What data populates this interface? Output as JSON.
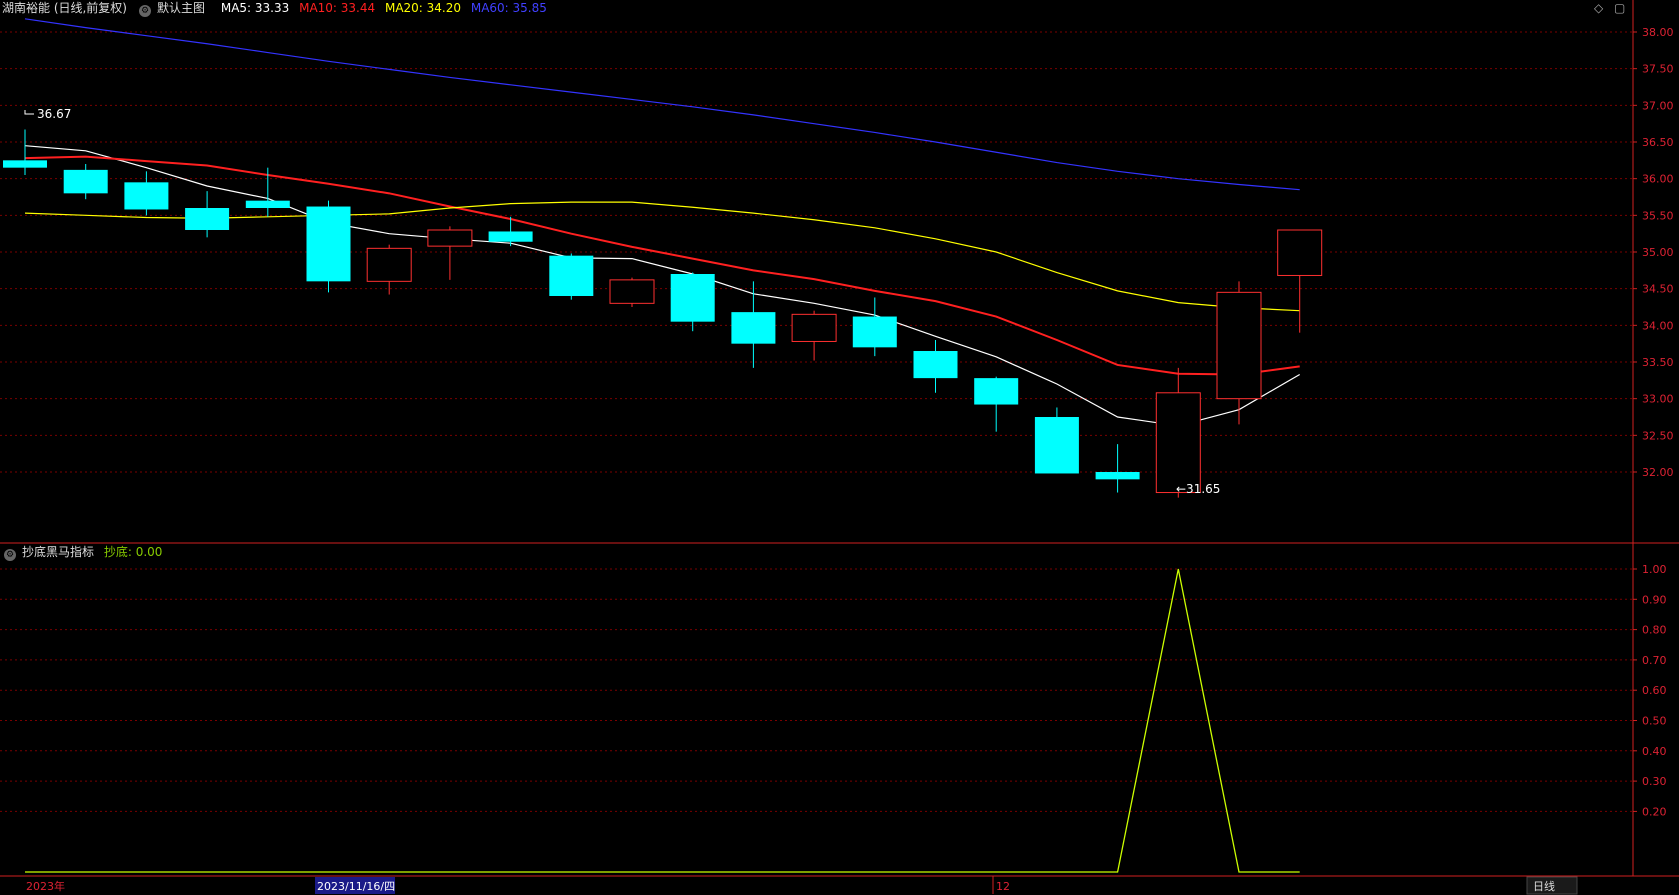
{
  "header": {
    "title": "湖南裕能 (日线,前复权)",
    "main_indicator": "默认主图",
    "ma": [
      {
        "label": "MA5: 33.33",
        "color": "#ffffff"
      },
      {
        "label": "MA10: 33.44",
        "color": "#ff2020"
      },
      {
        "label": "MA20: 34.20",
        "color": "#ffff00"
      },
      {
        "label": "MA60: 35.85",
        "color": "#3333ff"
      }
    ]
  },
  "sub_header": {
    "indicator_name": "抄底黑马指标",
    "value_label": "抄底: 0.00",
    "value_color": "#88cc00"
  },
  "annotations": {
    "high_label": "36.67",
    "low_label": "←31.65"
  },
  "x_axis": {
    "left_label": "2023年",
    "cursor_label": "2023/11/16/四",
    "mid_label": "12",
    "right_label": "日线"
  },
  "colors": {
    "up": "#ff3030",
    "down": "#00ffff",
    "grid": "#7a0000",
    "axis": "#d02020"
  },
  "chart_data": [
    {
      "type": "candlestick",
      "ylim": [
        31.6,
        38.2
      ],
      "y_ticks": [
        "38.00",
        "37.50",
        "37.00",
        "36.50",
        "36.00",
        "35.50",
        "35.00",
        "34.50",
        "34.00",
        "33.50",
        "33.00",
        "32.50",
        "32.00"
      ],
      "candles": [
        {
          "o": 36.25,
          "h": 36.67,
          "l": 36.05,
          "c": 36.15
        },
        {
          "o": 36.12,
          "h": 36.2,
          "l": 35.72,
          "c": 35.8
        },
        {
          "o": 35.95,
          "h": 36.1,
          "l": 35.5,
          "c": 35.58
        },
        {
          "o": 35.6,
          "h": 35.83,
          "l": 35.2,
          "c": 35.3
        },
        {
          "o": 35.7,
          "h": 36.15,
          "l": 35.48,
          "c": 35.6
        },
        {
          "o": 35.62,
          "h": 35.7,
          "l": 34.45,
          "c": 34.6
        },
        {
          "o": 34.6,
          "h": 35.1,
          "l": 34.42,
          "c": 35.05
        },
        {
          "o": 35.08,
          "h": 35.35,
          "l": 34.62,
          "c": 35.3
        },
        {
          "o": 35.28,
          "h": 35.48,
          "l": 35.08,
          "c": 35.14
        },
        {
          "o": 34.95,
          "h": 34.98,
          "l": 34.35,
          "c": 34.4
        },
        {
          "o": 34.3,
          "h": 34.65,
          "l": 34.25,
          "c": 34.62
        },
        {
          "o": 34.7,
          "h": 34.72,
          "l": 33.92,
          "c": 34.05
        },
        {
          "o": 34.18,
          "h": 34.6,
          "l": 33.42,
          "c": 33.75
        },
        {
          "o": 33.78,
          "h": 34.2,
          "l": 33.52,
          "c": 34.15
        },
        {
          "o": 34.12,
          "h": 34.38,
          "l": 33.58,
          "c": 33.7
        },
        {
          "o": 33.65,
          "h": 33.8,
          "l": 33.08,
          "c": 33.28
        },
        {
          "o": 33.28,
          "h": 33.3,
          "l": 32.55,
          "c": 32.92
        },
        {
          "o": 32.75,
          "h": 32.88,
          "l": 31.98,
          "c": 31.98
        },
        {
          "o": 32.0,
          "h": 32.38,
          "l": 31.72,
          "c": 31.9
        },
        {
          "o": 31.72,
          "h": 33.42,
          "l": 31.65,
          "c": 33.08
        },
        {
          "o": 33.0,
          "h": 34.6,
          "l": 32.65,
          "c": 34.45
        },
        {
          "o": 34.68,
          "h": 35.3,
          "l": 33.9,
          "c": 35.3
        }
      ],
      "series": [
        {
          "name": "MA5",
          "color": "#ffffff",
          "values": [
            36.45,
            36.38,
            36.15,
            35.9,
            35.73,
            35.4,
            35.25,
            35.18,
            35.12,
            34.92,
            34.91,
            34.7,
            34.43,
            34.3,
            34.14,
            33.85,
            33.57,
            33.2,
            32.75,
            32.63,
            32.85,
            33.33
          ]
        },
        {
          "name": "MA10",
          "color": "#ff2020",
          "values": [
            36.28,
            36.3,
            36.24,
            36.18,
            36.05,
            35.93,
            35.8,
            35.62,
            35.45,
            35.25,
            35.07,
            34.91,
            34.75,
            34.63,
            34.47,
            34.33,
            34.12,
            33.8,
            33.46,
            33.34,
            33.33,
            33.44
          ]
        },
        {
          "name": "MA20",
          "color": "#ffff00",
          "values": [
            35.53,
            35.5,
            35.47,
            35.46,
            35.48,
            35.5,
            35.52,
            35.6,
            35.66,
            35.68,
            35.68,
            35.61,
            35.53,
            35.44,
            35.33,
            35.18,
            35.0,
            34.72,
            34.47,
            34.31,
            34.24,
            34.2
          ]
        },
        {
          "name": "MA60",
          "color": "#3333ff",
          "values": [
            38.18,
            38.06,
            37.95,
            37.84,
            37.72,
            37.6,
            37.49,
            37.38,
            37.28,
            37.18,
            37.08,
            36.98,
            36.87,
            36.75,
            36.63,
            36.5,
            36.36,
            36.22,
            36.1,
            36.0,
            35.92,
            35.85
          ]
        }
      ]
    },
    {
      "type": "line",
      "ylim": [
        0,
        1.05
      ],
      "y_ticks": [
        "1.00",
        "0.90",
        "0.80",
        "0.70",
        "0.60",
        "0.50",
        "0.40",
        "0.30",
        "0.20"
      ],
      "series": [
        {
          "name": "抄底",
          "color": "#ccff00",
          "values": [
            0,
            0,
            0,
            0,
            0,
            0,
            0,
            0,
            0,
            0,
            0,
            0,
            0,
            0,
            0,
            0,
            0,
            0,
            0,
            1,
            0,
            0
          ]
        }
      ]
    }
  ]
}
